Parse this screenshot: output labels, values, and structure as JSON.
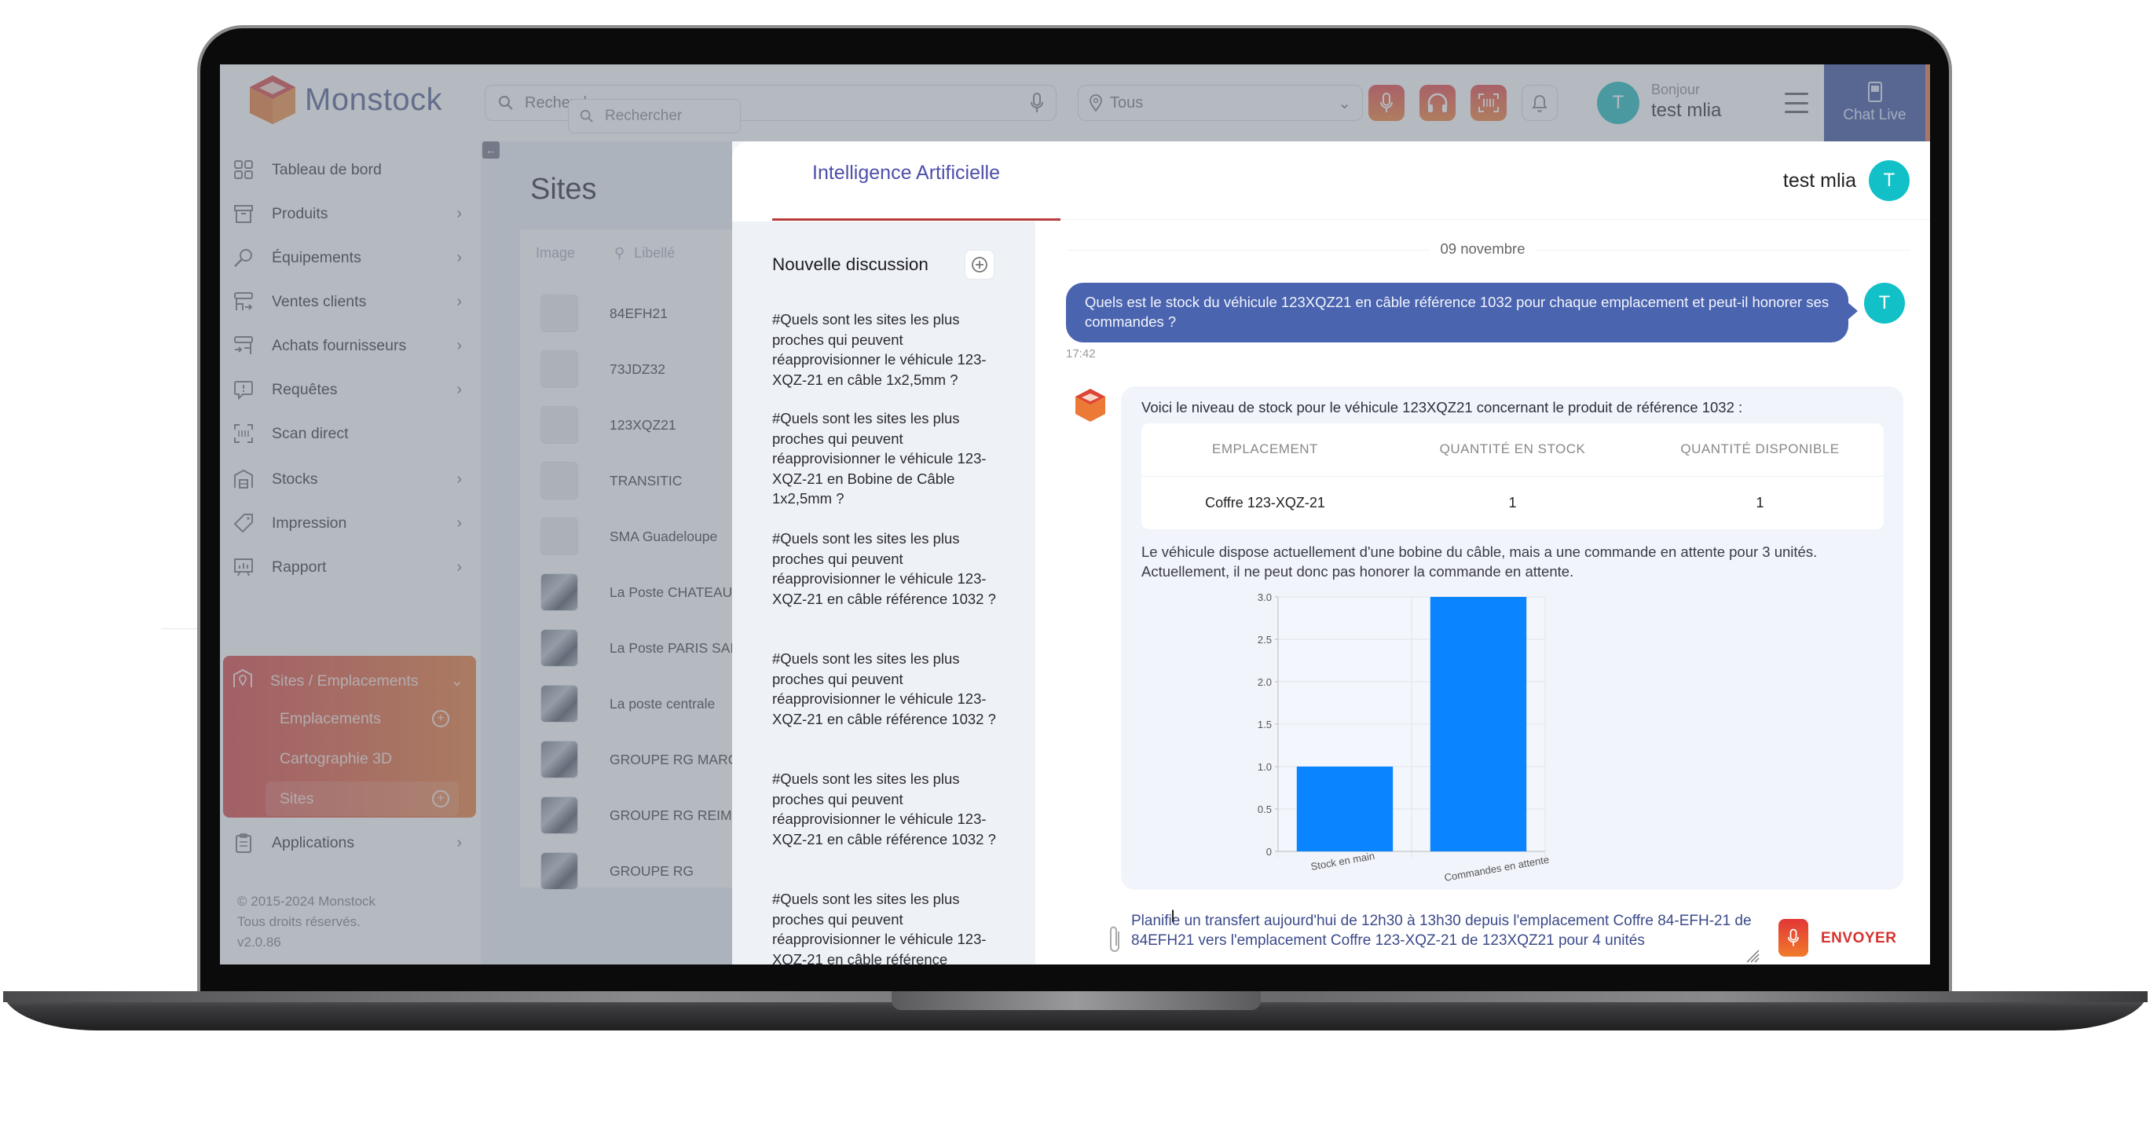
{
  "header": {
    "brand": "Monstock",
    "search_placeholder": "Recherche",
    "location_filter": "Tous",
    "greeting": "Bonjour",
    "user_name": "test mlia",
    "avatar_initial": "T",
    "chat_live_label": "Chat Live",
    "icons": [
      "microphone-icon",
      "headset-icon",
      "barcode-scan-icon",
      "bell-icon",
      "menu-icon"
    ]
  },
  "sidebar": {
    "items": [
      {
        "label": "Tableau de bord",
        "icon": "dashboard-icon",
        "has_chevron": false
      },
      {
        "label": "Produits",
        "icon": "box-icon",
        "has_chevron": true
      },
      {
        "label": "Équipements",
        "icon": "wrench-icon",
        "has_chevron": true
      },
      {
        "label": "Ventes clients",
        "icon": "store-out-icon",
        "has_chevron": true
      },
      {
        "label": "Achats fournisseurs",
        "icon": "store-in-icon",
        "has_chevron": true
      },
      {
        "label": "Requêtes",
        "icon": "alert-bubble-icon",
        "has_chevron": true
      },
      {
        "label": "Scan direct",
        "icon": "scan-icon",
        "has_chevron": false
      },
      {
        "label": "Stocks",
        "icon": "warehouse-icon",
        "has_chevron": true
      },
      {
        "label": "Impression",
        "icon": "tag-icon",
        "has_chevron": true
      },
      {
        "label": "Rapport",
        "icon": "report-icon",
        "has_chevron": true
      }
    ],
    "sites_group": {
      "label": "Sites / Emplacements",
      "subitems": [
        {
          "label": "Emplacements",
          "has_add": true
        },
        {
          "label": "Cartographie 3D",
          "has_add": false
        },
        {
          "label": "Sites",
          "has_add": true,
          "active": true
        }
      ]
    },
    "applications_label": "Applications",
    "copyright": [
      "© 2015-2024 Monstock",
      "Tous droits réservés.",
      "v2.0.86"
    ]
  },
  "sites_page": {
    "title": "Sites",
    "search_placeholder": "Rechercher",
    "columns": [
      "Image",
      "Libellé"
    ],
    "rows": [
      {
        "label": "84EFH21",
        "photo": false
      },
      {
        "label": "73JDZ32",
        "photo": false
      },
      {
        "label": "123XQZ21",
        "photo": false
      },
      {
        "label": "TRANSITIC",
        "photo": false
      },
      {
        "label": "SMA Guadeloupe",
        "photo": false
      },
      {
        "label": "La Poste CHATEAU",
        "photo": true
      },
      {
        "label": "La Poste PARIS SAI",
        "photo": true
      },
      {
        "label": "La poste centrale",
        "photo": true
      },
      {
        "label": "GROUPE RG MARQ",
        "photo": true
      },
      {
        "label": "GROUPE RG REIMS",
        "photo": true
      },
      {
        "label": "GROUPE RG",
        "photo": true
      }
    ]
  },
  "ai_modal": {
    "tab_label": "Intelligence Artificielle",
    "user_name": "test mlia",
    "avatar_initial": "T",
    "new_discussion_label": "Nouvelle discussion",
    "discussions": [
      "#Quels sont les sites les plus proches qui peuvent réapprovisionner le véhicule 123-XQZ-21 en câble 1x2,5mm ?",
      "#Quels sont les sites les plus proches qui peuvent réapprovisionner le véhicule 123-XQZ-21 en Bobine de Câble 1x2,5mm ?",
      "#Quels sont les sites les plus proches qui peuvent réapprovisionner le véhicule 123-XQZ-21 en câble référence 1032 ?",
      "#Quels sont les sites les plus proches qui peuvent réapprovisionner le véhicule 123-XQZ-21 en câble référence 1032 ?",
      "#Quels sont les sites les plus proches qui peuvent réapprovisionner le véhicule 123-XQZ-21 en câble référence 1032 ?",
      "#Quels sont les sites les plus proches qui peuvent réapprovisionner le véhicule 123-XQZ-21 en câble référence"
    ],
    "date_separator": "09 novembre",
    "user_message": "Quels est le stock du véhicule 123XQZ21 en câble référence 1032 pour chaque emplacement et peut-il honorer ses commandes ?",
    "user_message_time": "17:42",
    "ai_intro": "Voici le niveau de stock pour le véhicule 123XQZ21 concernant le produit de référence 1032 :",
    "table": {
      "columns": [
        "EMPLACEMENT",
        "QUANTITÉ EN STOCK",
        "QUANTITÉ DISPONIBLE"
      ],
      "rows": [
        [
          "Coffre 123-XQZ-21",
          "1",
          "1"
        ]
      ]
    },
    "ai_conclusion": "Le véhicule dispose actuellement d'une bobine du câble, mais a une commande en attente pour 3 unités. Actuellement, il ne peut donc pas honorer la commande en attente.",
    "input_value": "Planifie un transfert aujourd'hui de 12h30 à 13h30 depuis l'emplacement Coffre 84-EFH-21 de 84EFH21 vers l'emplacement Coffre 123-XQZ-21 de 123XQZ21 pour 4 unités",
    "send_label": "ENVOYER"
  },
  "colors": {
    "brand_red": "#d63a3a",
    "brand_orange": "#e8762e",
    "user_bubble": "#4a64b0",
    "avatar_teal": "#12c0c8",
    "bar": "#0a84ff",
    "chat_live": "#2f4a9a"
  },
  "chart_data": {
    "type": "bar",
    "categories": [
      "Stock en main",
      "Commandes en attente"
    ],
    "values": [
      1,
      3
    ],
    "title": "",
    "xlabel": "",
    "ylabel": "",
    "ylim": [
      0,
      3
    ],
    "yticks": [
      0,
      0.5,
      1.0,
      1.5,
      2.0,
      2.5,
      3.0
    ],
    "ytick_labels": [
      "0",
      "0.5",
      "1.0",
      "1.5",
      "2.0",
      "2.5",
      "3.0"
    ],
    "grid": true,
    "legend": "none",
    "bar_color": "#0a84ff",
    "x_labels_rotated": true
  }
}
